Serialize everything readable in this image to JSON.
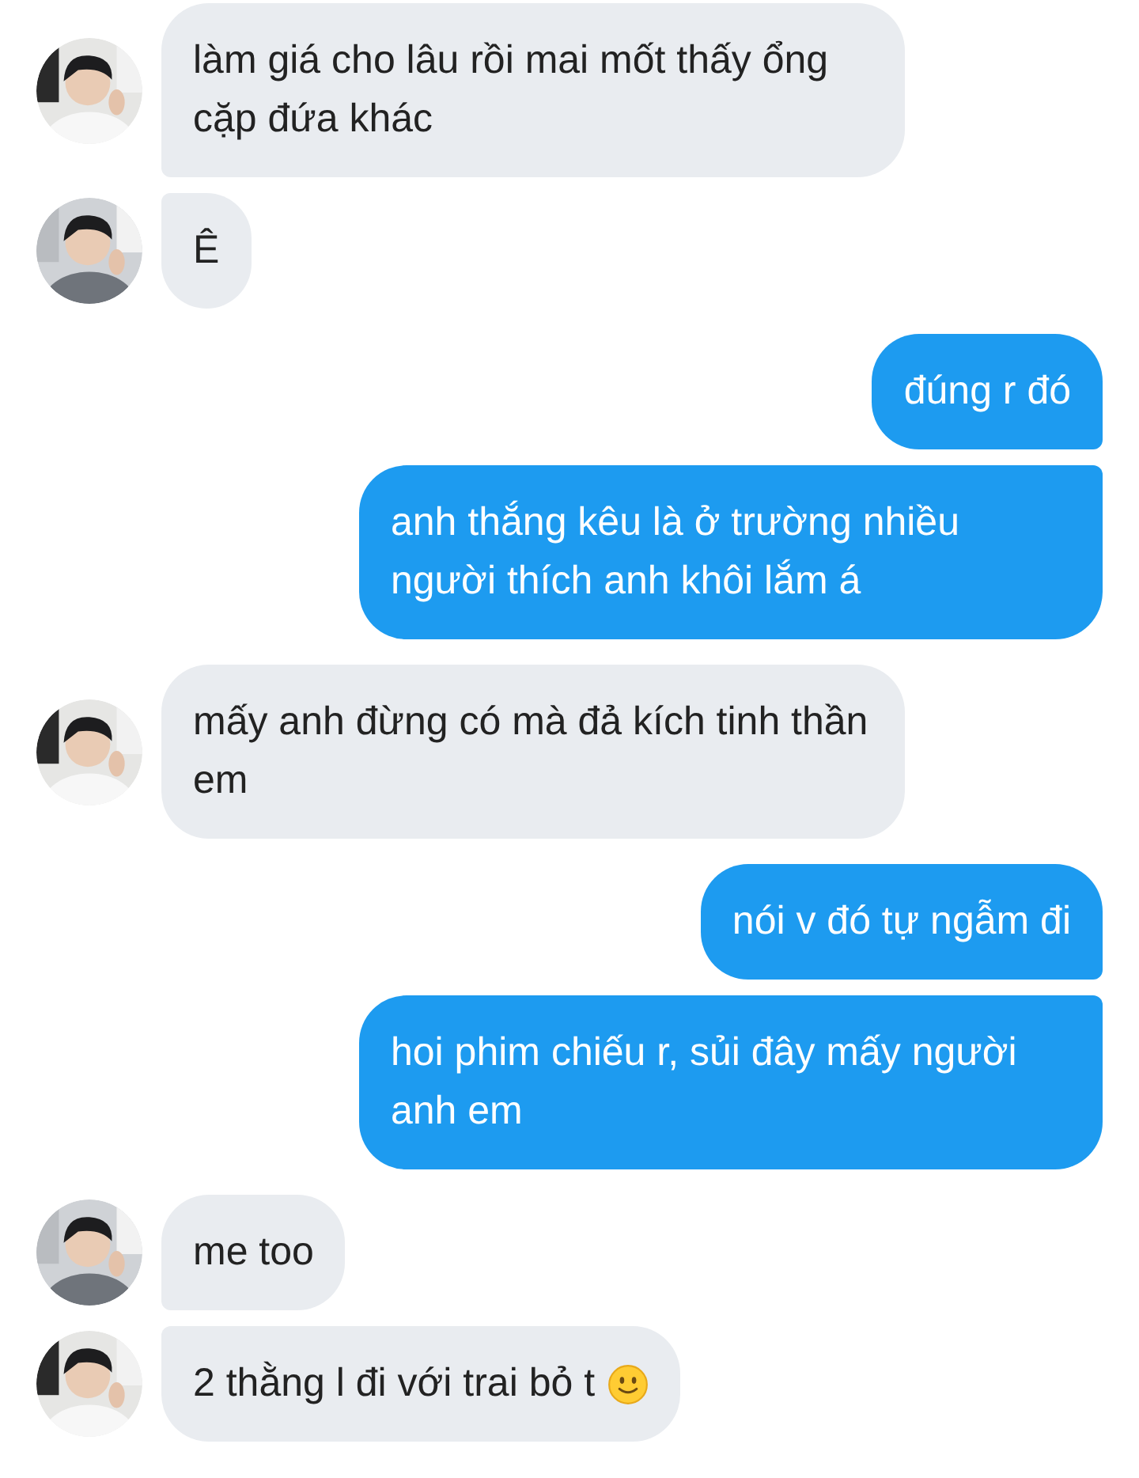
{
  "messages": [
    {
      "kind": "received",
      "text": "làm giá cho lâu rồi mai mốt thấy ổng cặp đứa khác",
      "emoji": false
    },
    {
      "kind": "received",
      "text": "Ê",
      "emoji": false
    },
    {
      "kind": "sent",
      "text": "đúng r đó",
      "emoji": false
    },
    {
      "kind": "sent",
      "text": "anh thắng kêu là ở trường nhiều người thích anh khôi lắm á",
      "emoji": false
    },
    {
      "kind": "received",
      "text": "mấy anh đừng có mà đả kích tinh thần em",
      "emoji": false
    },
    {
      "kind": "sent",
      "text": "nói v đó tự ngẫm đi",
      "emoji": false
    },
    {
      "kind": "sent",
      "text": "hoi phim chiếu r, sủi đây mấy người anh em",
      "emoji": false
    },
    {
      "kind": "received",
      "text": "me too",
      "emoji": false
    },
    {
      "kind": "received",
      "text": "2 thằng l đi với trai bỏ t",
      "emoji": true
    }
  ]
}
